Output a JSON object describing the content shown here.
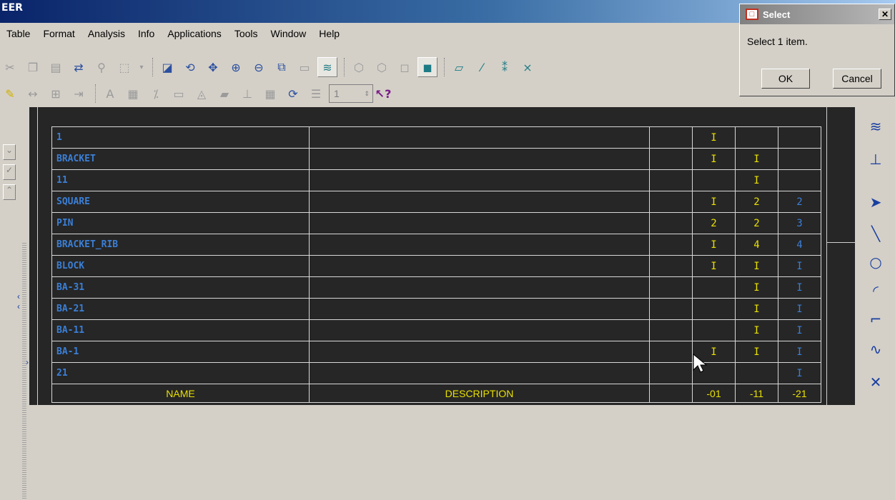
{
  "window": {
    "title": "EER"
  },
  "menu": [
    "Table",
    "Format",
    "Analysis",
    "Info",
    "Applications",
    "Tools",
    "Window",
    "Help"
  ],
  "toolbar_row1": [
    "cut-icon",
    "copy-icon",
    "paste-icon",
    "regenerate-icon",
    "find-icon",
    "select-box-icon",
    "select-dropdown-icon",
    "repaint-icon",
    "spin-icon",
    "orient-icon",
    "zoom-in-icon",
    "zoom-out-icon",
    "refit-icon",
    "saved-views-icon",
    "layers-icon",
    "wireframe-icon",
    "hidden-line-icon",
    "no-hidden-icon",
    "shading-icon",
    "datum-planes-icon",
    "datum-axes-icon",
    "datum-points-icon",
    "csys-icon"
  ],
  "toolbar_row2": [
    "note-icon",
    "dimension-icon",
    "table-icon",
    "split-icon",
    "text-style-icon",
    "hatch-icon",
    "offset-icon",
    "dim-mm-icon",
    "balloon-icon",
    "folder-icon",
    "hierarchy-icon",
    "grid-icon",
    "table-repeat-icon",
    "list-icon",
    "context-help-icon"
  ],
  "spinner": {
    "value": "1"
  },
  "dialog": {
    "title": "Select",
    "message": "Select 1 item.",
    "ok": "OK",
    "cancel": "Cancel"
  },
  "bom_table": {
    "rows": [
      [
        "1",
        "",
        "",
        "I",
        "",
        ""
      ],
      [
        "BRACKET",
        "",
        "",
        "I",
        "I",
        ""
      ],
      [
        "11",
        "",
        "",
        "",
        "I",
        ""
      ],
      [
        "SQUARE",
        "",
        "",
        "I",
        "2",
        "2"
      ],
      [
        "PIN",
        "",
        "",
        "2",
        "2",
        "3"
      ],
      [
        "BRACKET_RIB",
        "",
        "",
        "I",
        "4",
        "4"
      ],
      [
        "BLOCK",
        "",
        "",
        "I",
        "I",
        "I"
      ],
      [
        "BA-31",
        "",
        "",
        "",
        "I",
        "I"
      ],
      [
        "BA-21",
        "",
        "",
        "",
        "I",
        "I"
      ],
      [
        "BA-11",
        "",
        "",
        "",
        "I",
        "I"
      ],
      [
        "BA-1",
        "",
        "",
        "I",
        "I",
        "I"
      ],
      [
        "21",
        "",
        "",
        "",
        "",
        "I"
      ]
    ],
    "header": [
      "NAME",
      "DESCRIPTION",
      "",
      "-01",
      "-11",
      "-21"
    ],
    "colors": {
      "yellow": "#e8e000",
      "blue": "#3b7fd6"
    }
  },
  "right_toolbar": [
    "sketcher-tools-icon",
    "constraints-icon",
    "select-arrow-icon",
    "line-icon",
    "circle-icon",
    "arc-icon",
    "fillet-icon",
    "spline-icon",
    "point-icon"
  ]
}
